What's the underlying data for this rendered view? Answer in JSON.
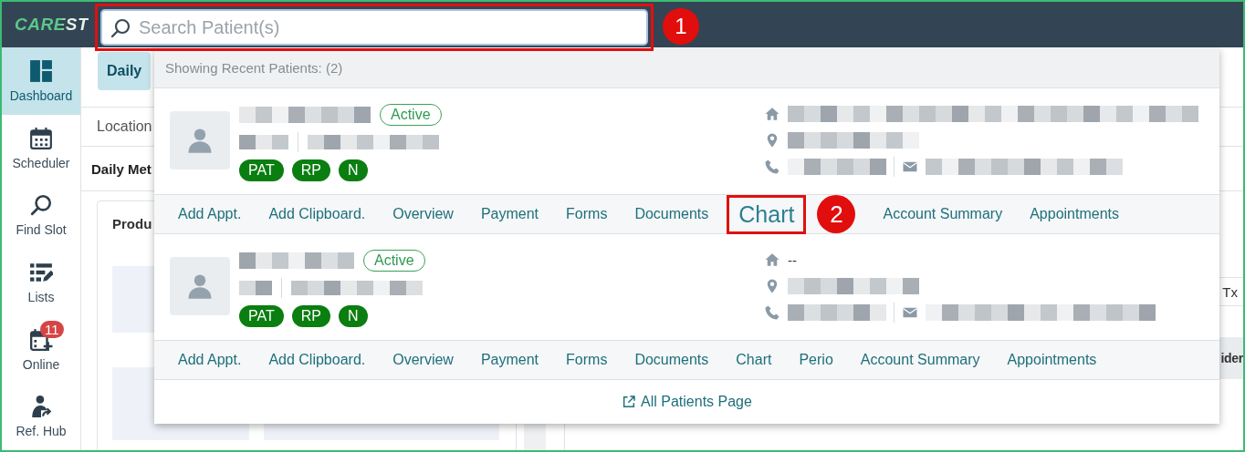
{
  "logo": "CAREST",
  "search": {
    "placeholder": "Search Patient(s)",
    "highlighted": true,
    "callout": "1"
  },
  "sidebar": {
    "items": [
      {
        "label": "Dashboard",
        "selected": true
      },
      {
        "label": "Scheduler",
        "selected": false
      },
      {
        "label": "Find Slot",
        "selected": false
      },
      {
        "label": "Lists",
        "selected": false
      },
      {
        "label": "Online",
        "selected": false,
        "badge": "11"
      },
      {
        "label": "Ref. Hub",
        "selected": false
      }
    ]
  },
  "background": {
    "tab": {
      "label": "Daily",
      "selected": true
    },
    "location_label": "Location",
    "section_title": "Daily Met",
    "card_title": "Produ",
    "right_texts": [
      "Tx",
      "ider"
    ]
  },
  "recent_patients": {
    "header": "Showing Recent Patients:  (2)",
    "patients": [
      {
        "status": "Active",
        "tags": [
          "PAT",
          "RP",
          "N"
        ],
        "actions": [
          {
            "label": "Add Appt.",
            "highlighted": false
          },
          {
            "label": "Add Clipboard.",
            "highlighted": false
          },
          {
            "label": "Overview",
            "highlighted": false
          },
          {
            "label": "Payment",
            "highlighted": false
          },
          {
            "label": "Forms",
            "highlighted": false
          },
          {
            "label": "Documents",
            "highlighted": false
          },
          {
            "label": "Chart",
            "highlighted": true,
            "callout": "2"
          },
          {
            "label": "Account Summary",
            "highlighted": false
          },
          {
            "label": "Appointments",
            "highlighted": false
          }
        ]
      },
      {
        "status": "Active",
        "tags": [
          "PAT",
          "RP",
          "N"
        ],
        "address": "--",
        "actions": [
          {
            "label": "Add Appt.",
            "highlighted": false
          },
          {
            "label": "Add Clipboard.",
            "highlighted": false
          },
          {
            "label": "Overview",
            "highlighted": false
          },
          {
            "label": "Payment",
            "highlighted": false
          },
          {
            "label": "Forms",
            "highlighted": false
          },
          {
            "label": "Documents",
            "highlighted": false
          },
          {
            "label": "Chart",
            "highlighted": false
          },
          {
            "label": "Perio",
            "highlighted": false
          },
          {
            "label": "Account Summary",
            "highlighted": false
          },
          {
            "label": "Appointments",
            "highlighted": false
          }
        ]
      }
    ],
    "footer_link": "All Patients Page"
  }
}
